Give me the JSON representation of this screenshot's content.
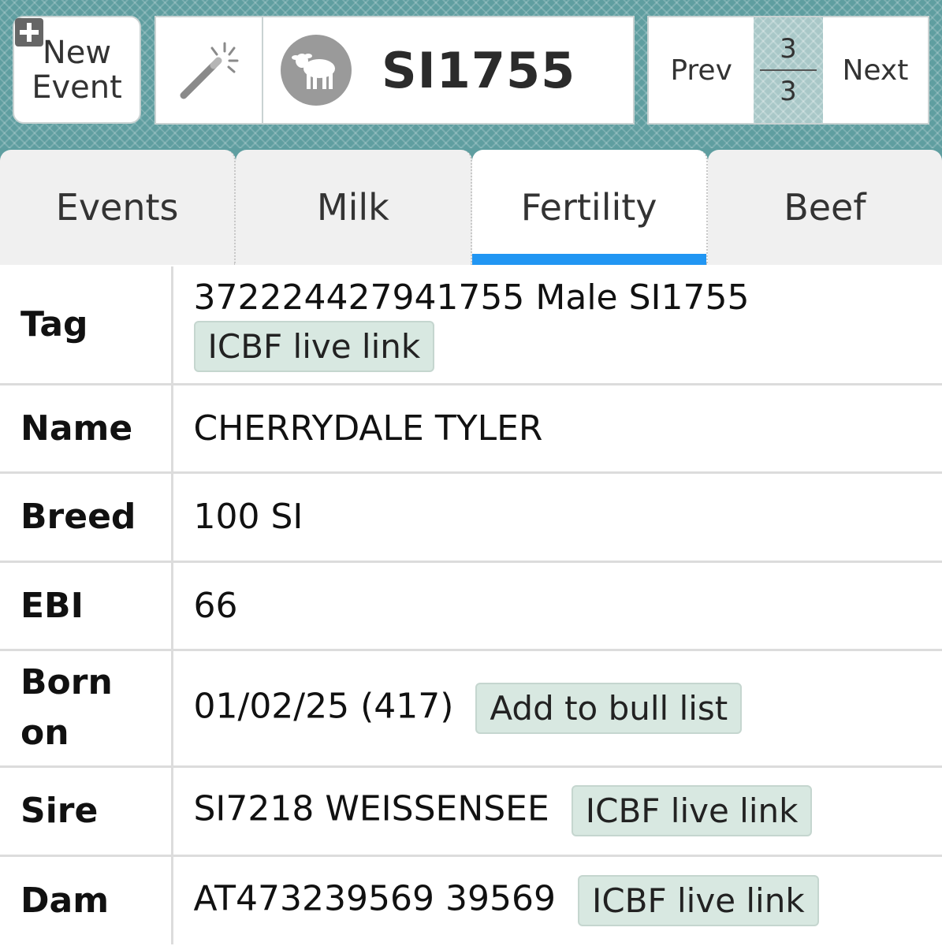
{
  "header": {
    "new_event_line1": "New",
    "new_event_line2": "Event",
    "animal_id": "SI1755",
    "pager": {
      "prev": "Prev",
      "current": "3",
      "total": "3",
      "next": "Next"
    }
  },
  "tabs": [
    {
      "label": "Events",
      "active": false
    },
    {
      "label": "Milk",
      "active": false
    },
    {
      "label": "Fertility",
      "active": true
    },
    {
      "label": "Beef",
      "active": false
    }
  ],
  "details": {
    "tag": {
      "label": "Tag",
      "value": "372224427941755 Male SI1755",
      "link": "ICBF live link"
    },
    "name": {
      "label": "Name",
      "value": "CHERRYDALE TYLER"
    },
    "breed": {
      "label": "Breed",
      "value": "100 SI"
    },
    "ebi": {
      "label": "EBI",
      "value": "66"
    },
    "born": {
      "label_line1": "Born",
      "label_line2": "on",
      "value": "01/02/25 (417)",
      "action": "Add to bull list"
    },
    "sire": {
      "label": "Sire",
      "value": "SI7218 WEISSENSEE",
      "link": "ICBF live link"
    },
    "dam": {
      "label": "Dam",
      "value": "AT473239569 39569",
      "link": "ICBF live link"
    }
  },
  "colors": {
    "header_bg": "#5f9ea0",
    "active_tab_underline": "#2196f3",
    "chip_bg": "#d8e8e1"
  },
  "icons": [
    "plus-icon",
    "magic-wand-icon",
    "calf-icon"
  ]
}
